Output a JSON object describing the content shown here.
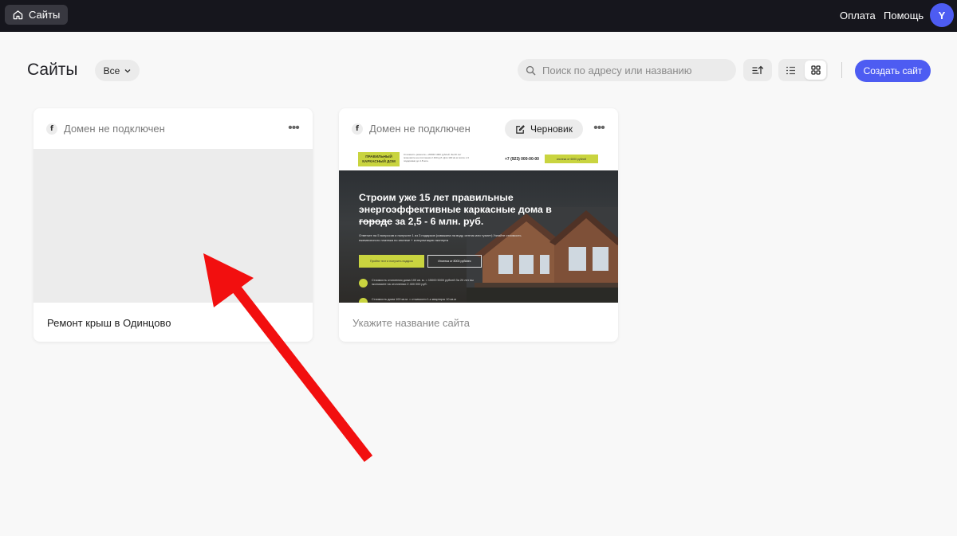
{
  "topbar": {
    "home_label": "Сайты",
    "links": {
      "payment": "Оплата",
      "help": "Помощь"
    },
    "avatar_initial": "Y"
  },
  "header": {
    "title": "Сайты",
    "filter_label": "Все",
    "search_placeholder": "Поиск по адресу или названию",
    "create_label": "Создать сайт",
    "active_view": "grid"
  },
  "cards": [
    {
      "domain_status": "Домен не подключен",
      "name": "Ремонт крыш в Одинцово",
      "has_preview": false
    },
    {
      "domain_status": "Домен не подключен",
      "badge": "Черновик",
      "name_placeholder": "Укажите название сайта",
      "has_preview": true,
      "preview": {
        "logo": "ПРАВИЛЬНЫЙ КАРКАСНЫЙ ДОМ",
        "topline": "Стоимость ремонта + 20000 1000 рублей. За 20 лет экономите на отоплении 2 400 руб. Для 100 кв.м после и 3 подарками до 4.8 млн.",
        "phone": "+7 (923) 000-00-00",
        "top_cta": "ипотека от 6000 рублей",
        "headline_1": "Строим уже 15 лет правильные энергоэффективные каркасные дома в ",
        "headline_strike": "городе",
        "headline_2": " за 2,5 - 6 млн. руб.",
        "subtext": "Ответьте на 5 вопросов и получите 1 из 3 подарков (скважина на воду, септик или туалет) Узнайте стоимость ежемесячного платежа по ипотеке + консультацию эксперта",
        "btn_primary": "Пройти тест и получить подарок",
        "btn_secondary": "Ипотека от 8000 руб/мес",
        "bullet_1": "Стоимость отопления дома 100 кв. м. = 15000 5000 рублей За 20 лет вы экономите на отоплении 2 400 000 руб.",
        "bullet_2": "Стоимость дома 100 кв.м. = стоимости 1-к квартиры 10 кв.м"
      }
    }
  ],
  "colors": {
    "accent": "#4d5cf2",
    "topbar": "#16161d",
    "annotation_arrow": "#f20f0f"
  }
}
